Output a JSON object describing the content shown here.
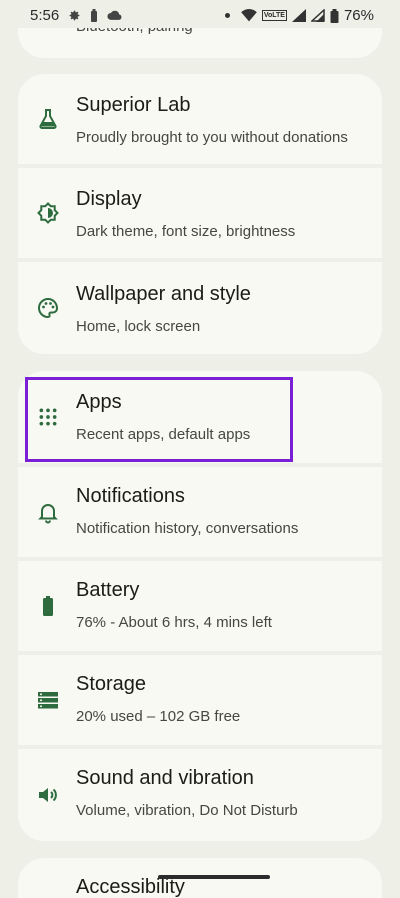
{
  "status_bar": {
    "time": "5:56",
    "battery_percent": "76%",
    "volte_label": "VoLTE"
  },
  "top_partial": {
    "subtitle": "Bluetooth, pairing"
  },
  "items": [
    {
      "id": "superior-lab",
      "title": "Superior Lab",
      "subtitle": "Proudly brought to you without donations",
      "icon": "flask-icon"
    },
    {
      "id": "display",
      "title": "Display",
      "subtitle": "Dark theme, font size, brightness",
      "icon": "brightness-icon"
    },
    {
      "id": "wallpaper",
      "title": "Wallpaper and style",
      "subtitle": "Home, lock screen",
      "icon": "palette-icon"
    },
    {
      "id": "apps",
      "title": "Apps",
      "subtitle": "Recent apps, default apps",
      "icon": "apps-grid-icon"
    },
    {
      "id": "notifications",
      "title": "Notifications",
      "subtitle": "Notification history, conversations",
      "icon": "bell-icon"
    },
    {
      "id": "battery",
      "title": "Battery",
      "subtitle": "76% - About 6 hrs, 4 mins left",
      "icon": "battery-icon"
    },
    {
      "id": "storage",
      "title": "Storage",
      "subtitle": "20% used – 102 GB free",
      "icon": "storage-icon"
    },
    {
      "id": "sound",
      "title": "Sound and vibration",
      "subtitle": "Volume, vibration, Do Not Disturb",
      "icon": "volume-icon"
    }
  ],
  "bottom_partial": {
    "title": "Accessibility"
  },
  "colors": {
    "background": "#eef0e8",
    "card": "#f8f9f2",
    "icon": "#2e6b3f",
    "highlight": "#7a1fd6"
  }
}
